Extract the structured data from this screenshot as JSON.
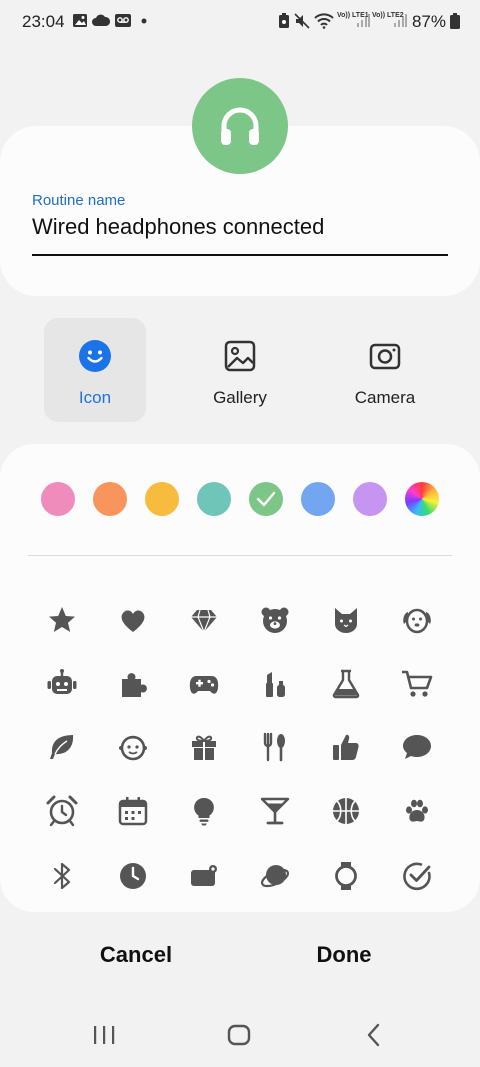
{
  "status_bar": {
    "time": "23:04",
    "lte1": "Vo)) LTE1",
    "lte2": "Vo)) LTE2",
    "battery": "87%"
  },
  "routine": {
    "icon": "headphones-icon",
    "icon_color": "#7cc688",
    "name_label": "Routine name",
    "name_value": "Wired headphones connected"
  },
  "sources": [
    {
      "label": "Icon",
      "icon": "smiley-icon",
      "selected": true
    },
    {
      "label": "Gallery",
      "icon": "image-icon",
      "selected": false
    },
    {
      "label": "Camera",
      "icon": "camera-icon",
      "selected": false
    }
  ],
  "colors": [
    "#f08cbc",
    "#f7955d",
    "#f7bc3d",
    "#6ec5b8",
    "#7cc688",
    "#73a6f0",
    "#c695f2",
    "spectrum"
  ],
  "selected_color_index": 4,
  "icons": [
    [
      "star-icon",
      "heart-icon",
      "diamond-icon",
      "bear-icon",
      "cat-icon",
      "dog-icon"
    ],
    [
      "robot-icon",
      "puzzle-icon",
      "gamepad-icon",
      "cosmetics-icon",
      "flask-icon",
      "cart-icon"
    ],
    [
      "leaf-icon",
      "baby-icon",
      "gift-icon",
      "utensils-icon",
      "thumbs-up-icon",
      "chat-icon"
    ],
    [
      "alarm-icon",
      "calendar-icon",
      "lightbulb-icon",
      "cocktail-icon",
      "basketball-icon",
      "paw-icon"
    ],
    [
      "bluetooth-icon",
      "clock-icon",
      "wallet-icon",
      "planet-icon",
      "watch-icon",
      "check-circle-icon"
    ]
  ],
  "actions": {
    "cancel": "Cancel",
    "done": "Done"
  }
}
